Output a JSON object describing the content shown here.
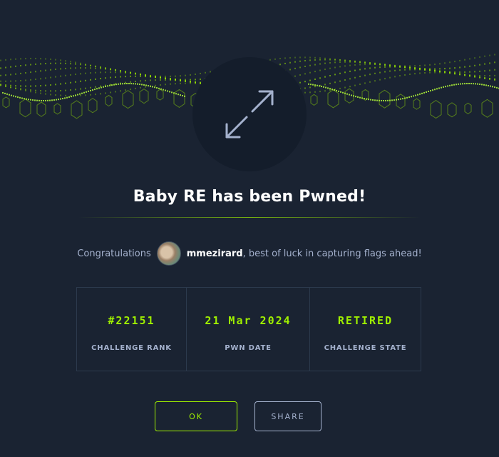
{
  "banner": {
    "image": "green-voxel-wave-banner"
  },
  "badge": {
    "icon": "arrows-diagonal-icon"
  },
  "title": "Baby RE has been Pwned!",
  "congrats": {
    "prefix": "Congratulations",
    "username": "mmezirard",
    "suffix": ", best of luck in capturing flags ahead!"
  },
  "stats": [
    {
      "value": "#22151",
      "label": "CHALLENGE RANK"
    },
    {
      "value": "21 Mar 2024",
      "label": "PWN DATE"
    },
    {
      "value": "RETIRED",
      "label": "CHALLENGE STATE"
    }
  ],
  "buttons": {
    "ok": "OK",
    "share": "SHARE"
  },
  "colors": {
    "accent": "#9fef00",
    "background": "#1a2332",
    "muted": "#a4b1cd"
  }
}
